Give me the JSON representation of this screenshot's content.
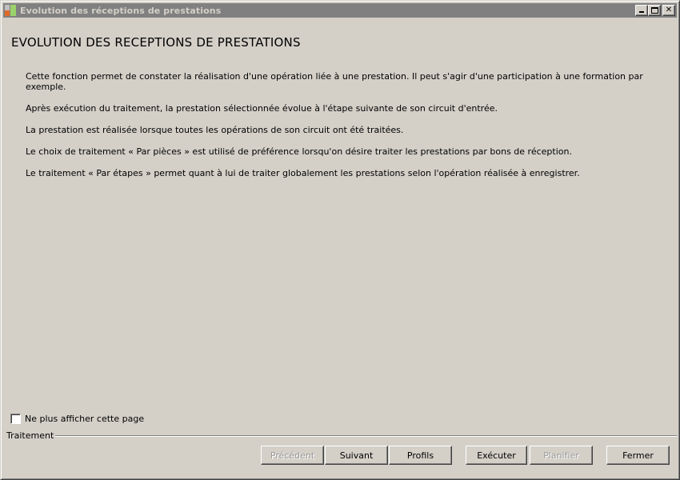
{
  "window": {
    "title": "Evolution des réceptions de prestations"
  },
  "heading": "EVOLUTION DES RECEPTIONS DE PRESTATIONS",
  "description": [
    "Cette fonction permet de constater la réalisation d'une opération liée à une prestation. Il peut s'agir d'une participation à une formation par exemple.",
    "Après exécution du traitement, la prestation sélectionnée évolue à l'étape suivante de son circuit d'entrée.",
    "La prestation est réalisée lorsque toutes les opérations de son circuit ont été traitées.",
    "Le choix de traitement « Par pièces » est utilisé de préférence lorsqu'on désire traiter les prestations par bons de réception.",
    "Le traitement « Par étapes » permet quant à lui de traiter globalement les prestations selon l'opération réalisée à enregistrer."
  ],
  "checkbox": {
    "label": "Ne plus afficher cette page",
    "checked": false
  },
  "group": {
    "label": "Traitement"
  },
  "buttons": {
    "previous": "Précédent",
    "next": "Suivant",
    "profiles": "Profils",
    "execute": "Exécuter",
    "schedule": "Planifier",
    "close": "Fermer"
  },
  "icons": {
    "app": "app-icon",
    "minimize": "minimize-icon",
    "maximize": "maximize-icon",
    "close": "close-icon"
  }
}
